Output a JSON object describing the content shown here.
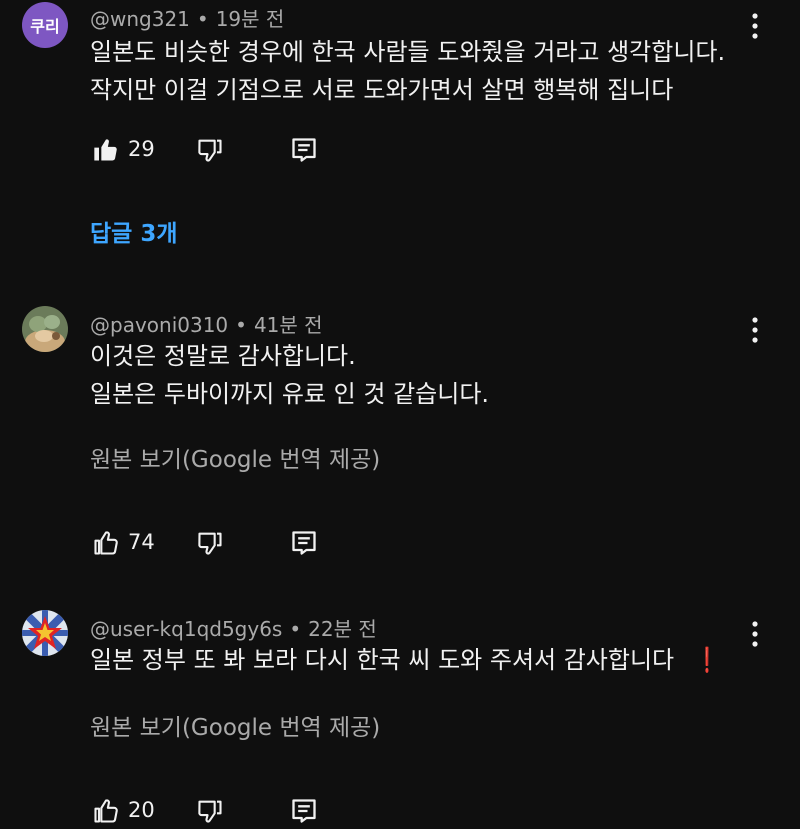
{
  "comments": [
    {
      "avatar_text": "쿠리",
      "author": "@wng321",
      "time": "19분 전",
      "lines": [
        "일본도 비슷한 경우에 한국 사람들 도와줬을 거라고 생각합니다.",
        "작지만 이걸 기점으로 서로 도와가면서 살면 행복해 집니다"
      ],
      "likes": "29",
      "replies_label": "답글 3개"
    },
    {
      "author": "@pavoni0310",
      "time": "41분 전",
      "lines": [
        "이것은 정말로 감사합니다.",
        "일본은 두바이까지 유료 인 것 같습니다."
      ],
      "translate_label": "원본 보기(Google 번역 제공)",
      "likes": "74"
    },
    {
      "author": "@user-kq1qd5gy6s",
      "time": "22분 전",
      "lines": [
        "일본 정부 또 봐 보라 다시 한국 씨 도와 주셔서 감사합니다"
      ],
      "emoji": "❗",
      "translate_label": "원본 보기(Google 번역 제공)",
      "likes": "20"
    }
  ],
  "separator": "•",
  "colors": {
    "background": "#0f0f0f",
    "text": "#f1f1f1",
    "meta": "#aaaaaa",
    "link": "#3ea6ff",
    "avatar_purple": "#7e57c2"
  },
  "icons": [
    "like-icon",
    "dislike-icon",
    "reply-icon",
    "more-options-icon"
  ]
}
